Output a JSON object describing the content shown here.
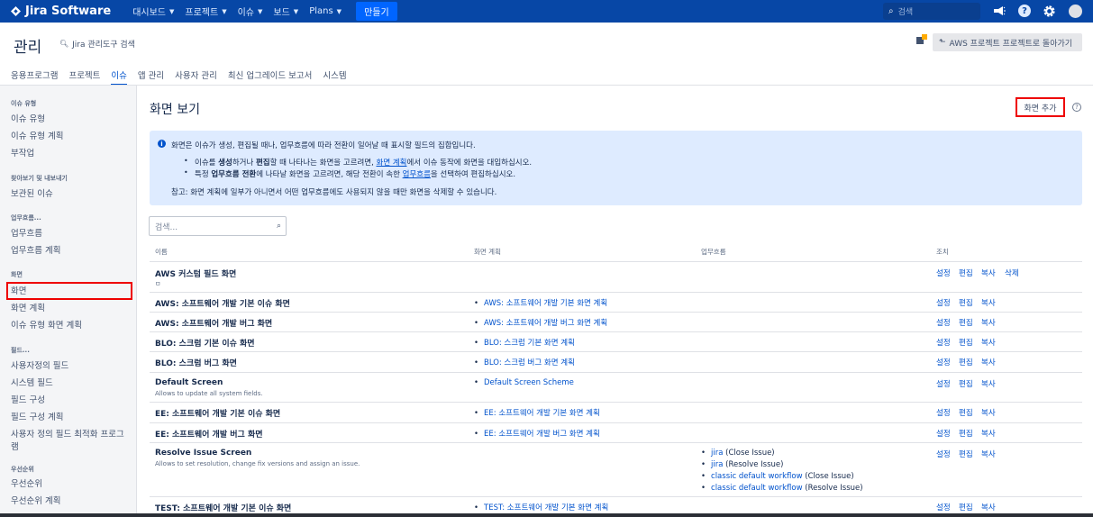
{
  "nav": {
    "logo": "Jira Software",
    "items": [
      "대시보드",
      "프로젝트",
      "이슈",
      "보드",
      "Plans"
    ],
    "create": "만들기",
    "search_placeholder": "검색"
  },
  "admin": {
    "title": "관리",
    "search": "Jira 관리도구 검색",
    "back": "AWS 프로젝트 프로젝트로 돌아가기",
    "tabs": [
      "응용프로그램",
      "프로젝트",
      "이슈",
      "앱 관리",
      "사용자 관리",
      "최신 업그레이드 보고서",
      "시스템"
    ]
  },
  "sidebar": {
    "issue_types_heading": "이슈 유형",
    "issue_types": "이슈 유형",
    "issue_type_schemes": "이슈 유형 계획",
    "subtasks": "부작업",
    "search_heading": "찾아보기 및 내보내기",
    "saved": "보관된 이슈",
    "workflow_heading": "업무흐름...",
    "workflows": "업무흐름",
    "workflow_schemes": "업무흐름 계획",
    "screens_heading": "화면",
    "screens": "화면",
    "screen_schemes": "화면 계획",
    "issue_type_screen_schemes": "이슈 유형 화면 계획",
    "fields_heading": "필드...",
    "custom_fields": "사용자정의 필드",
    "system_fields": "시스템 필드",
    "field_config": "필드 구성",
    "field_config_schemes": "필드 구성 계획",
    "custom_field_opt_1": "사용자 정의 필드 최적화 프로그",
    "custom_field_opt_2": "램",
    "priority_heading": "우선순위",
    "priorities": "우선순위",
    "priority_schemes": "우선순위 계획"
  },
  "main": {
    "heading": "화면 보기",
    "add_button": "화면 추가",
    "info": {
      "line1": "화면은 이슈가 생성, 편집될 때나, 업무흐름에 따라 전환이 일어날 때 표시할 필드의 집합입니다.",
      "b1_a": "이슈를 ",
      "b1_b": "생성",
      "b1_c": "하거나 ",
      "b1_d": "편집",
      "b1_e": "할 때 나타나는 화면을 고르려면, ",
      "b1_link": "화면 계획",
      "b1_f": "에서 이슈 동작에 화면을 대입하십시오.",
      "b2_a": "특정 ",
      "b2_b": "업무흐름 전환",
      "b2_c": "에 나타날 화면을 고르려면, 해당 전환이 속한 ",
      "b2_link": "업무흐름",
      "b2_d": "을 선택하여 편집하십시오.",
      "note": "참고: 화면 계획에 일부가 아니면서 어떤 업무흐름에도 사용되지 않을 때만 화면을 삭제할 수 있습니다."
    },
    "filter_placeholder": "검색...",
    "columns": [
      "이름",
      "화면 계획",
      "업무흐름",
      "조치"
    ],
    "actions": {
      "settings": "설정",
      "edit": "편집",
      "copy": "복사",
      "delete": "삭제"
    },
    "rows": [
      {
        "name": "AWS 커스텀 필드 화면",
        "desc": "ㅁ",
        "scheme": ""
      },
      {
        "name": "AWS: 소프트웨어 개발 기본 이슈 화면",
        "desc": "",
        "scheme": "AWS: 소프트웨어 개발 기본 화면 계획"
      },
      {
        "name": "AWS: 소프트웨어 개발 버그 화면",
        "desc": "",
        "scheme": "AWS: 소프트웨어 개발 버그 화면 계획"
      },
      {
        "name": "BLO: 스크럼 기본 이슈 화면",
        "desc": "",
        "scheme": "BLO: 스크럼 기본 화면 계획"
      },
      {
        "name": "BLO: 스크럼 버그 화면",
        "desc": "",
        "scheme": "BLO: 스크럼 버그 화면 계획"
      },
      {
        "name": "Default Screen",
        "desc": "Allows to update all system fields.",
        "scheme": "Default Screen Scheme"
      },
      {
        "name": "EE: 소프트웨어 개발 기본 이슈 화면",
        "desc": "",
        "scheme": "EE: 소프트웨어 개발 기본 화면 계획"
      },
      {
        "name": "EE: 소프트웨어 개발 버그 화면",
        "desc": "",
        "scheme": "EE: 소프트웨어 개발 버그 화면 계획"
      },
      {
        "name": "Resolve Issue Screen",
        "desc": "Allows to set resolution, change fix versions and assign an issue.",
        "scheme": ""
      },
      {
        "name": "TEST: 소프트웨어 개발 기본 이슈 화면",
        "desc": "",
        "scheme": "TEST: 소프트웨어 개발 기본 화면 계획"
      }
    ],
    "workflows": [
      {
        "link": "jira",
        "note": " (Close Issue)"
      },
      {
        "link": "jira",
        "note": " (Resolve Issue)"
      },
      {
        "link": "classic default workflow",
        "note": " (Close Issue)"
      },
      {
        "link": "classic default workflow",
        "note": " (Resolve Issue)"
      }
    ]
  }
}
